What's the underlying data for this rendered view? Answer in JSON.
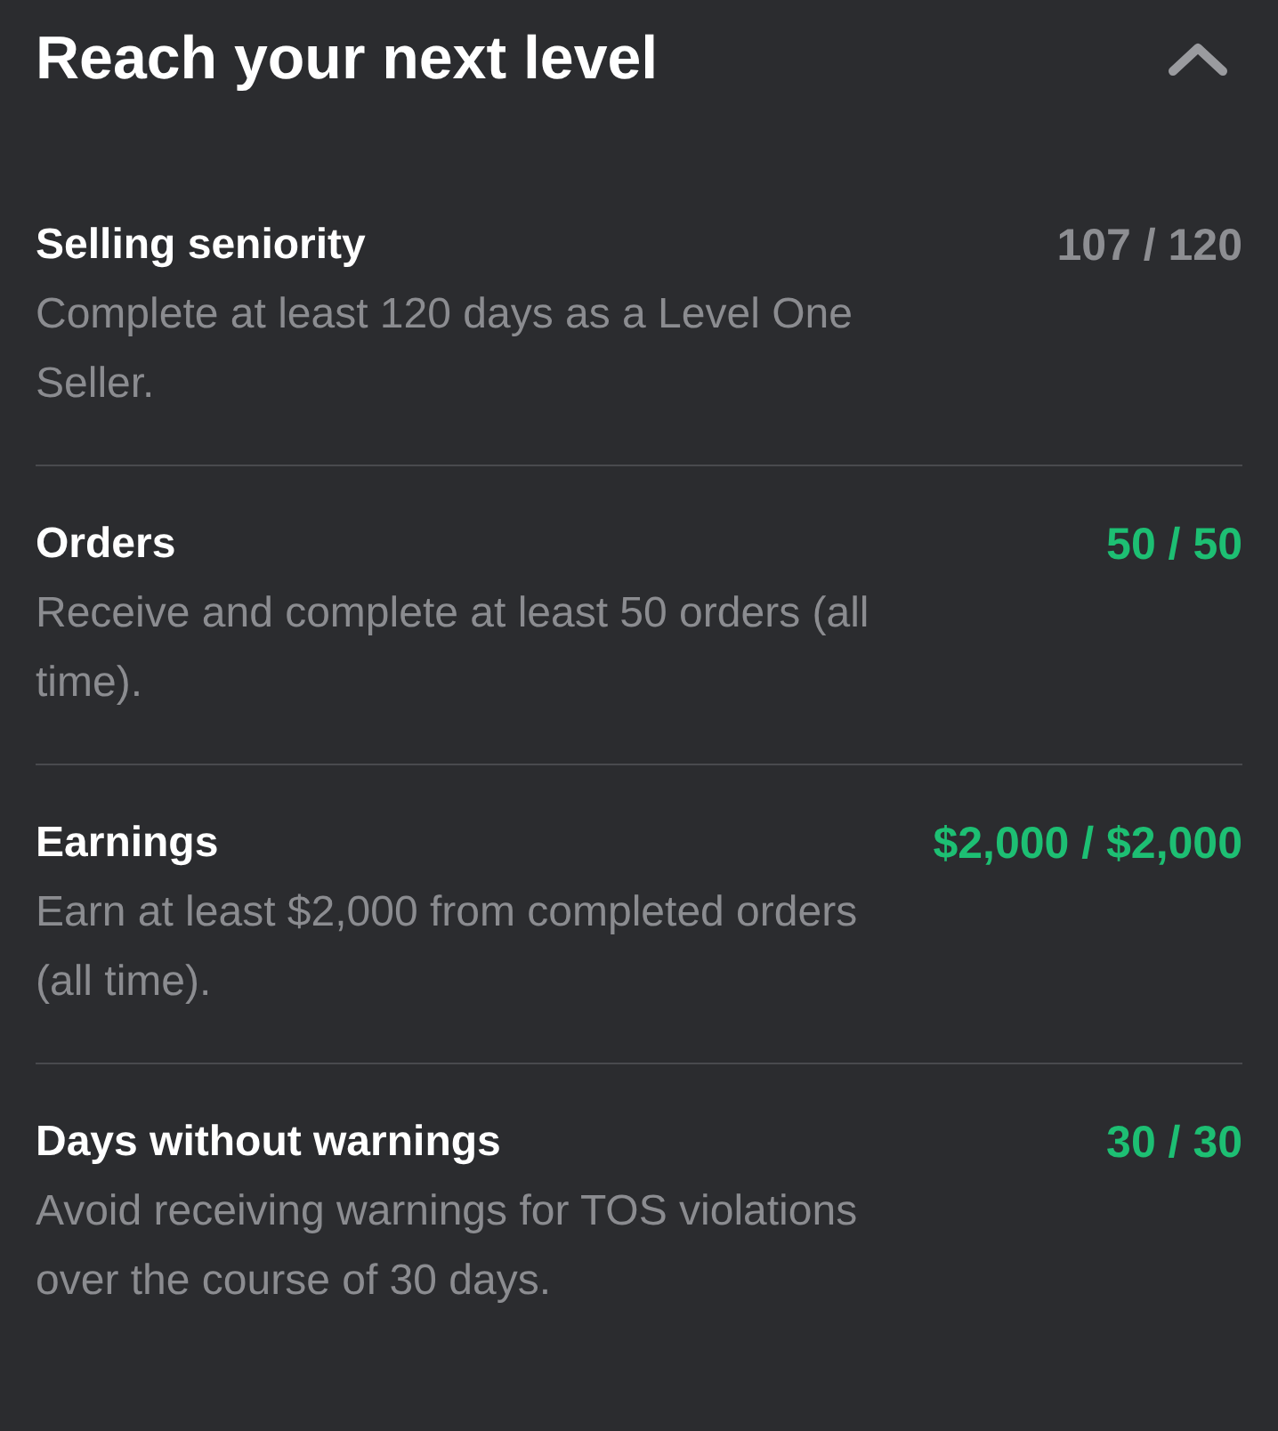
{
  "header": {
    "title": "Reach your next level",
    "expanded": true
  },
  "requirements": [
    {
      "title": "Selling seniority",
      "description": "Complete at least 120 days as a Level One Seller.",
      "progress": "107 / 120",
      "met": false
    },
    {
      "title": "Orders",
      "description": "Receive and complete at least 50 orders (all time).",
      "progress": "50 / 50",
      "met": true
    },
    {
      "title": "Earnings",
      "description": "Earn at least $2,000 from completed orders (all time).",
      "progress": "$2,000 / $2,000",
      "met": true
    },
    {
      "title": "Days without warnings",
      "description": "Avoid receiving warnings for TOS violations over the course of 30 days.",
      "progress": "30 / 30",
      "met": true
    }
  ]
}
